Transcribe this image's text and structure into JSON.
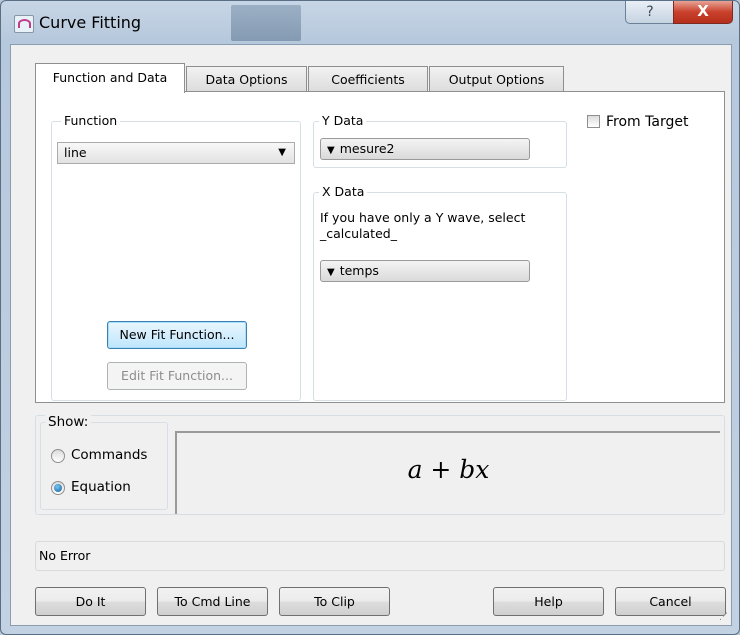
{
  "window": {
    "title": "Curve Fitting"
  },
  "tabs": [
    "Function and Data",
    "Data Options",
    "Coefficients",
    "Output Options"
  ],
  "function_group": {
    "label": "Function",
    "selected": "line",
    "new_button": "New Fit Function...",
    "edit_button": "Edit Fit Function..."
  },
  "ydata": {
    "label": "Y Data",
    "selected": "mesure2"
  },
  "xdata": {
    "label": "X Data",
    "hint": "If you have only a Y wave, select _calculated_",
    "selected": "temps"
  },
  "from_target": {
    "label": "From Target",
    "checked": false
  },
  "show": {
    "label": "Show:",
    "options": [
      "Commands",
      "Equation"
    ],
    "selected": "Equation",
    "equation": "a + bx"
  },
  "status": "No Error",
  "buttons": {
    "do_it": "Do It",
    "to_cmd_line": "To Cmd Line",
    "to_clip": "To Clip",
    "help": "Help",
    "cancel": "Cancel"
  }
}
